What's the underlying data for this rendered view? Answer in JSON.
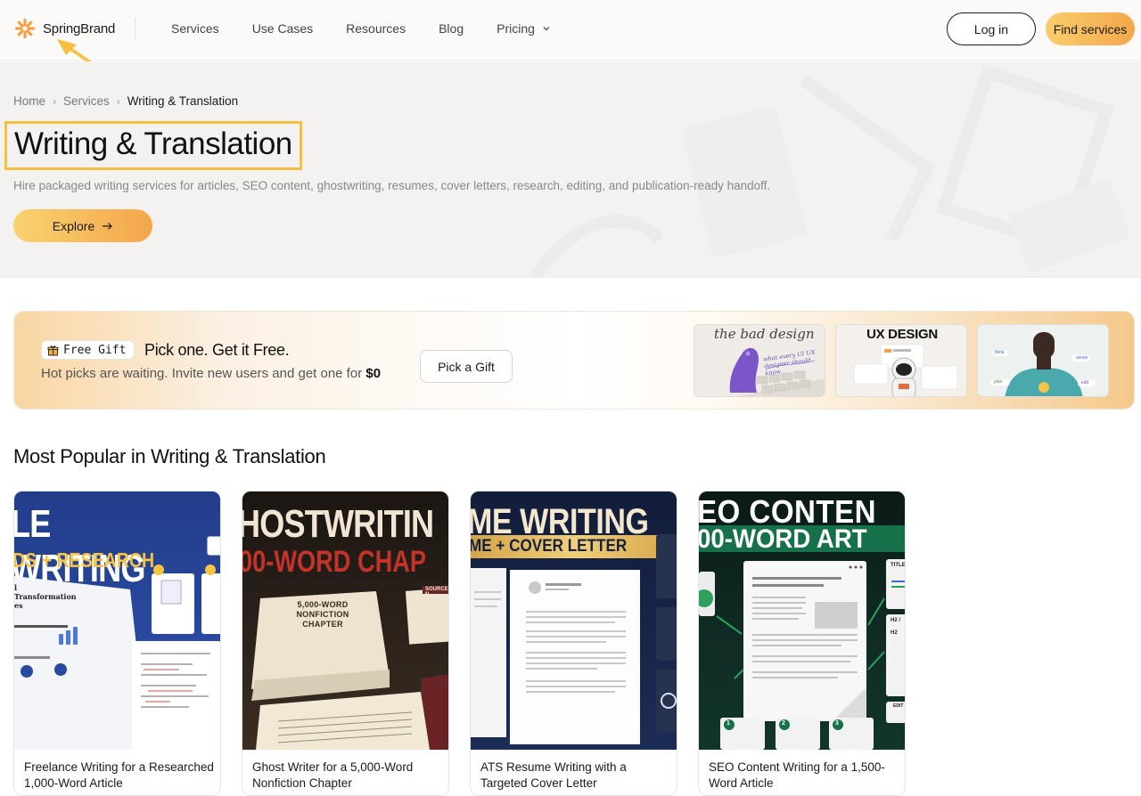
{
  "header": {
    "brand": "SpringBrand",
    "nav": [
      {
        "label": "Services"
      },
      {
        "label": "Use Cases"
      },
      {
        "label": "Resources"
      },
      {
        "label": "Blog"
      },
      {
        "label": "Pricing",
        "has_dropdown": true
      }
    ],
    "login_label": "Log in",
    "find_label": "Find services"
  },
  "hero": {
    "breadcrumb": [
      "Home",
      "Services",
      "Writing & Translation"
    ],
    "title": "Writing & Translation",
    "description": "Hire packaged writing services for articles, SEO content, ghostwriting, resumes, cover letters, research, editing, and publication-ready handoff.",
    "explore_label": "Explore"
  },
  "gift": {
    "badge": "Free Gift",
    "headline": "Pick one. Get it Free.",
    "subtext": "Hot picks are waiting. Invite new users and get one for",
    "price": "$0",
    "button_label": "Pick a Gift",
    "thumbs": [
      {
        "caption": "the bad design",
        "note": "what every UI UX designer should know"
      },
      {
        "caption": "UX DESIGN"
      },
      {
        "tags": [
          "think",
          "sense",
          "plan",
          "edit"
        ]
      }
    ]
  },
  "popular": {
    "title": "Most Popular in Writing & Translation",
    "cards": [
      {
        "title": "Freelance Writing for a Researched 1,000-Word Article",
        "banner": "LE WRITING",
        "sub": "DS + RESEARCH",
        "doc_heading": "l Transformation es"
      },
      {
        "title": "Ghost Writer for a 5,000-Word Nonfiction Chapter",
        "banner": "HOSTWRITIN",
        "sub": "00-WORD CHAP",
        "doc_heading": "5,000-WORD NONFICTION CHAPTER",
        "tag": "SOURCE N"
      },
      {
        "title": "ATS Resume Writing with a Targeted Cover Letter",
        "banner": "ME WRITING",
        "sub": "ME + COVER LETTER"
      },
      {
        "title": "SEO Content Writing for a 1,500-Word Article",
        "banner": "EO CONTEN",
        "sub": "00-WORD ART",
        "side_labels": [
          "TITLE",
          "H2 /",
          "H2",
          "EDIT"
        ],
        "steps": [
          "1",
          "2",
          "3"
        ]
      }
    ]
  },
  "colors": {
    "accent_start": "#f9cd6c",
    "accent_end": "#f4a74a",
    "highlight": "#f8bf3c",
    "annotation": "#f8bf3c"
  }
}
